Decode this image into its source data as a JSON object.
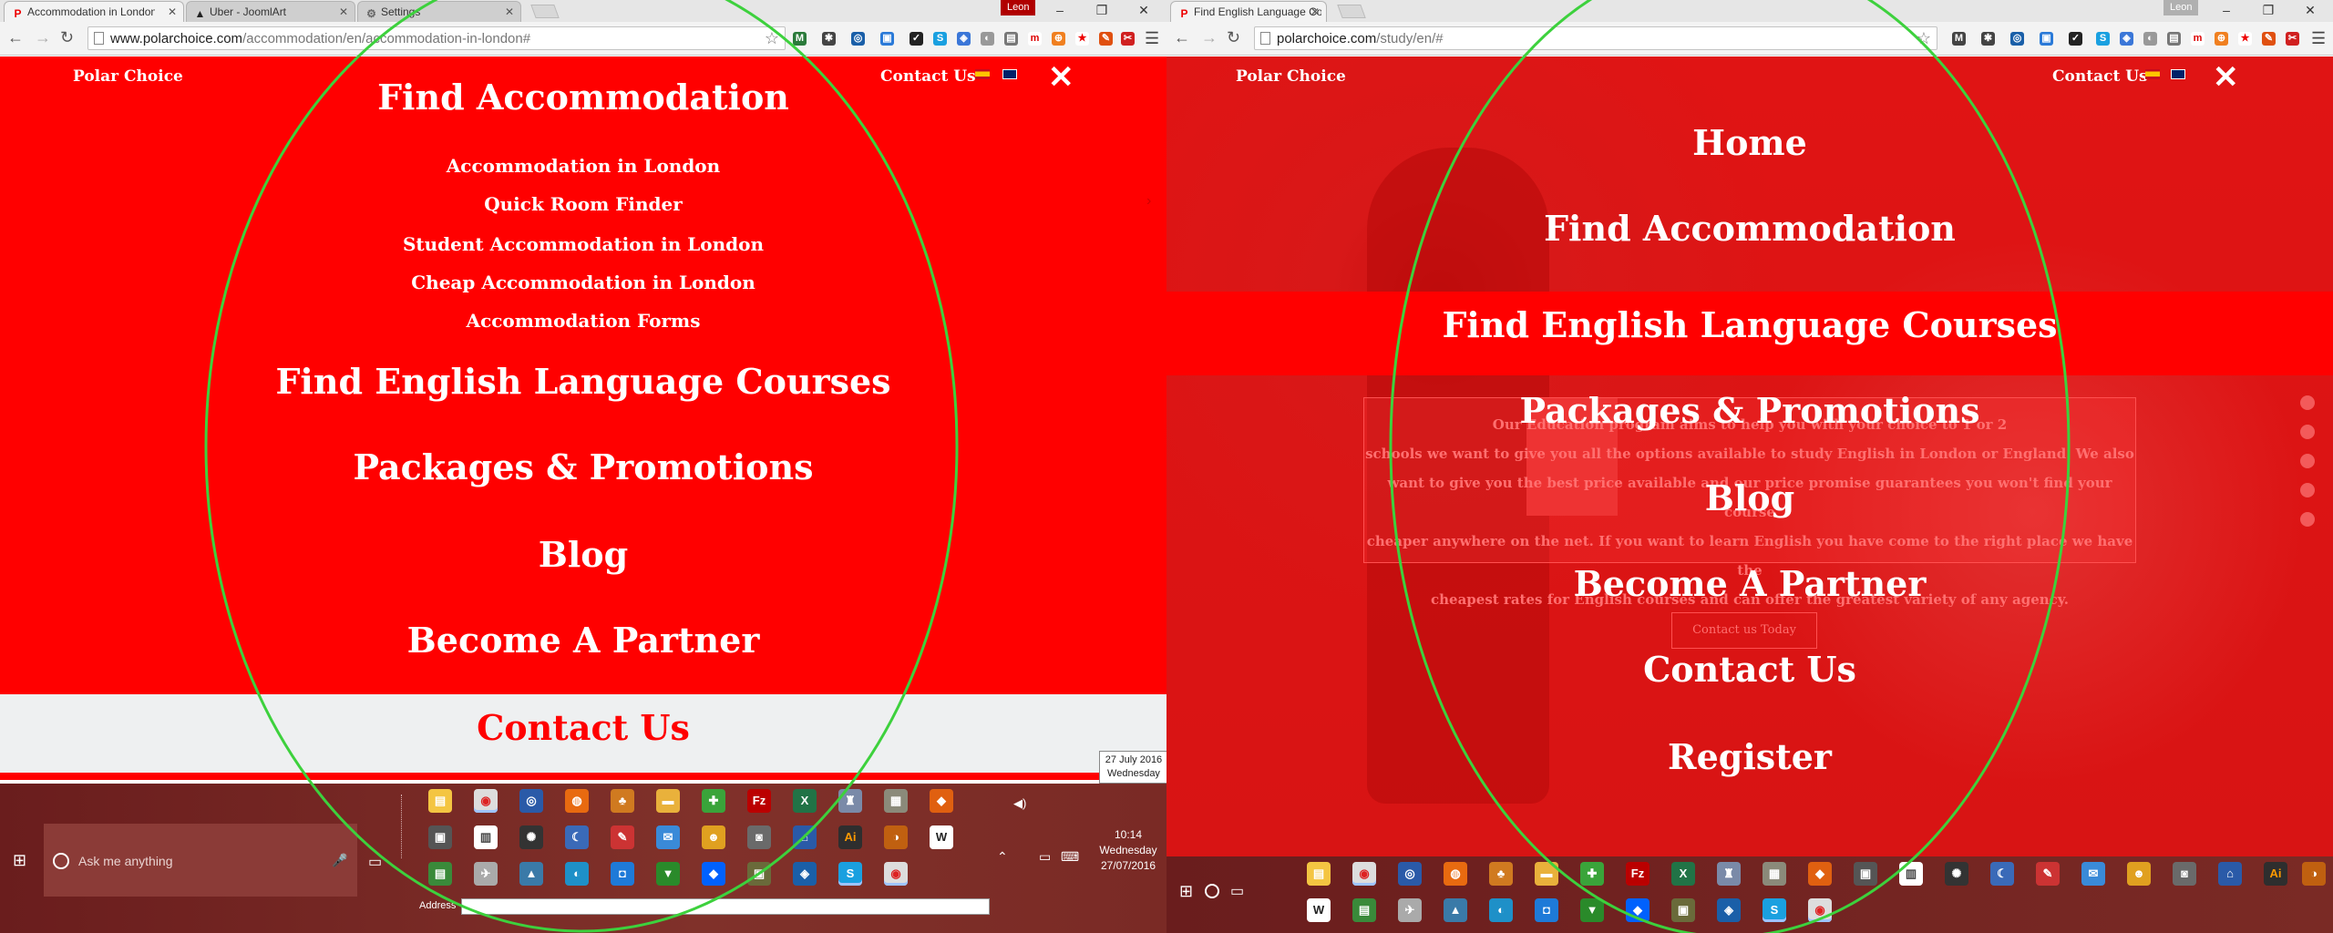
{
  "left": {
    "tabs": [
      {
        "label": "Accommodation in London"
      },
      {
        "label": "Uber - JoomlArt"
      },
      {
        "label": "Settings"
      }
    ],
    "user": "Leon",
    "url_host": "www.polarchoice.com",
    "url_path": "/accommodation/en/accommodation-in-london#",
    "brand": "Polar Choice",
    "contact_top": "Contact Us",
    "menu": {
      "find_accommodation": "Find Accommodation",
      "sub": [
        "Accommodation in London",
        "Quick Room Finder",
        "Student Accommodation in London",
        "Cheap Accommodation in London",
        "Accommodation Forms"
      ],
      "find_english": "Find English Language Courses",
      "packages": "Packages & Promotions",
      "blog": "Blog",
      "partner": "Become A Partner",
      "contact": "Contact Us"
    },
    "date_tooltip": {
      "line1": "27 July 2016",
      "line2": "Wednesday"
    },
    "taskbar": {
      "search_placeholder": "Ask me anything",
      "address_label": "Address",
      "time": "10:14",
      "day": "Wednesday",
      "date": "27/07/2016"
    }
  },
  "right": {
    "tabs": [
      {
        "label": "Find English Language Co"
      }
    ],
    "user": "Leon",
    "url_host": "polarchoice.com",
    "url_path": "/study/en/#",
    "brand": "Polar Choice",
    "contact_top": "Contact Us",
    "menu": {
      "home": "Home",
      "find_accommodation": "Find Accommodation",
      "find_english": "Find English Language Courses",
      "packages": "Packages & Promotions",
      "blog": "Blog",
      "partner": "Become A Partner",
      "contact": "Contact Us",
      "register": "Register"
    },
    "bg_text": {
      "line1": "Our Education program aims to help you with your choice to 1 or 2",
      "line1_right": "it your choice to 1 or 2",
      "line2": "schools we want to give you all the options available to study English in London or England. We also",
      "line3": "want to give you the best price available and our price promise guarantees you won't find your course",
      "line4": "cheaper anywhere on the net. If you want to learn English you have come to the right place we have the",
      "line5": "cheapest rates for English courses and can offer the greatest variety of any agency.",
      "button": "Contact us Today"
    }
  },
  "colors": {
    "brand_red": "#ff0000",
    "dark_red": "#7a1e1e",
    "highlight_green": "#3dd13d",
    "contact_bg": "#eef0f1"
  },
  "icons": [
    "back-arrow-icon",
    "forward-arrow-icon",
    "reload-icon",
    "star-icon",
    "menu-icon",
    "close-icon",
    "windows-start-icon",
    "cortana-icon",
    "mic-icon",
    "task-view-icon"
  ]
}
